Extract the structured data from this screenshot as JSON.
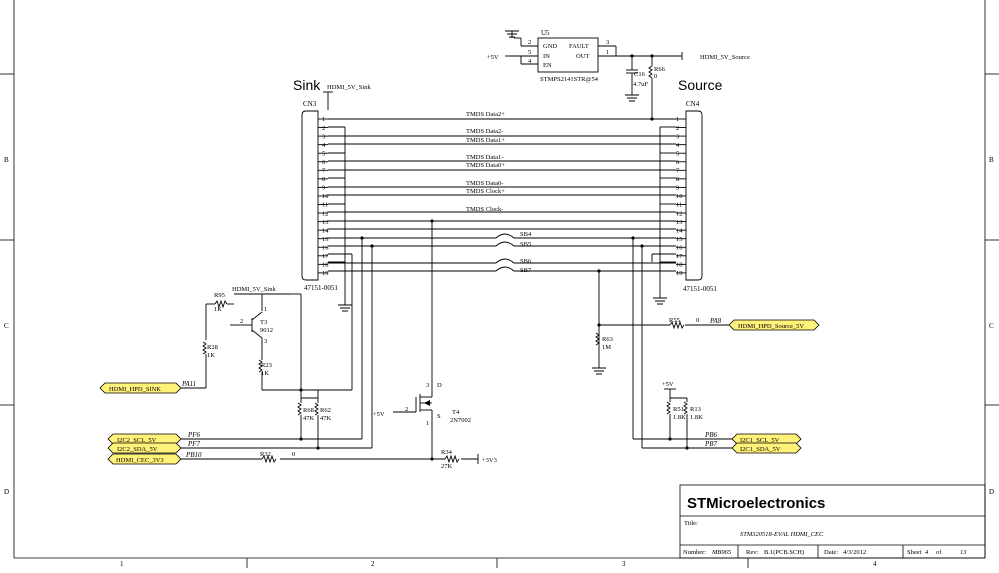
{
  "labels": {
    "sink": "Sink",
    "source": "Source",
    "hdmi_5v_sink_top": "HDMI_5V_Sink",
    "hdmi_5v_sink_left": "HDMI_5V_Sink",
    "hdmi_5v_source": "HDMI_5V_Source",
    "plus5v_u5": "+5V",
    "plus5v_t4": "+5V",
    "plus5v_r51": "+5V",
    "plus3v3": "+3V3"
  },
  "connectors": {
    "cn3": {
      "ref": "CN3",
      "part": "47151-0051"
    },
    "cn4": {
      "ref": "CN4",
      "part": "47151-0051"
    },
    "pins": [
      "1",
      "2",
      "3",
      "4",
      "5",
      "6",
      "7",
      "8",
      "9",
      "10",
      "11",
      "12",
      "13",
      "14",
      "15",
      "16",
      "17",
      "18",
      "19"
    ]
  },
  "tmds": [
    "TMDS Data2+",
    "TMDS Data2-",
    "TMDS Data1+",
    "TMDS Data1-",
    "TMDS Data0+",
    "TMDS Data0-",
    "TMDS Clock+",
    "TMDS Clock-"
  ],
  "solder_bridges": [
    "SB4",
    "SB5",
    "SB6",
    "SB7"
  ],
  "u5": {
    "ref": "U5",
    "part": "STMPS2141STR@54",
    "pin_gnd": "GND",
    "pin_in": "IN",
    "pin_en": "EN",
    "pin_fault": "FAULT",
    "pin_out": "OUT",
    "num_gnd": "2",
    "num_in": "5",
    "num_en": "4",
    "num_fault": "3",
    "num_out": "1"
  },
  "parts": {
    "c16_ref": "C16",
    "c16_val": "4.7uF",
    "r66_ref": "R66",
    "r66_val": "0",
    "r95_ref": "R95",
    "r95_val": "1K",
    "t3_ref": "T3",
    "t3_val": "9012",
    "t3_pin1": "1",
    "t3_pin2": "2",
    "t3_pin3": "3",
    "r28_ref": "R28",
    "r28_val": "1K",
    "r23_ref": "R23",
    "r23_val": "1K",
    "r68_ref": "R68",
    "r68_val": "47K",
    "r62_ref": "R62",
    "r62_val": "47K",
    "r32_ref": "R32",
    "r32_val": "0",
    "r34_ref": "R34",
    "r34_val": "27K",
    "t4_ref": "T4",
    "t4_val": "2N7002",
    "t4_g": "2",
    "t4_d": "D",
    "t4_s": "S",
    "t4_pin3": "3",
    "t4_pin1": "1",
    "r63_ref": "R63",
    "r63_val": "1M",
    "r55_ref": "R55",
    "r55_val": "0",
    "r51_ref": "R51",
    "r51_val": "1.8K",
    "r13_ref": "R13",
    "r13_val": "1.8K"
  },
  "ports": {
    "hdmi_hpd_sink": "HDMI_HPD_SINK",
    "i2c2_scl": "I2C2_SCL_5V",
    "i2c2_sda": "I2C2_SDA_5V",
    "hdmi_cec": "HDMI_CEC_3V3",
    "hdmi_hpd_source": "HDMI_HPD_Source_5V",
    "i2c1_scl": "I2C1_SCL_5V",
    "i2c1_sda": "I2C1_SDA_5V"
  },
  "nets": {
    "pa11": "PA11",
    "pf6": "PF6",
    "pf7": "PF7",
    "pb10": "PB10",
    "pa8": "PA8",
    "pb6": "PB6",
    "pb7": "PB7"
  },
  "frame": {
    "cols": [
      "1",
      "2",
      "3",
      "4"
    ],
    "rows_left": [
      "B",
      "C",
      "D"
    ],
    "rows_right": [
      "B",
      "C",
      "D"
    ]
  },
  "title_block": {
    "company": "STMicroelectronics",
    "title_label": "Title:",
    "title": "STM320518-EVAL HDMI_CEC",
    "number_label": "Number:",
    "number": "MB965",
    "rev_label": "Rev:",
    "rev": "B.1(PCB.SCH)",
    "date_label": "Date:",
    "date": "4/3/2012",
    "sheet_label": "Sheet",
    "sheet": "4",
    "of_label": "of",
    "total": "13"
  }
}
